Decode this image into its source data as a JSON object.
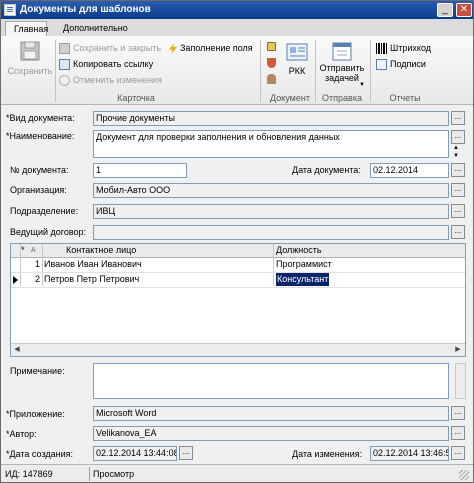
{
  "window": {
    "title": "Документы для шаблонов",
    "minimize_glyph": "_",
    "close_glyph": "✕"
  },
  "tabs": {
    "main": "Главная",
    "additional": "Дополнительно"
  },
  "ribbon": {
    "save": "Сохранить",
    "save_close": "Сохранить и закрыть",
    "copy_link": "Копировать ссылку",
    "cancel_changes": "Отменить изменения",
    "fill_fields": "Заполнение поля",
    "card_group": "Карточка",
    "rkk": "РКК",
    "document_group": "Документ",
    "send_tasks_1": "Отправить",
    "send_tasks_2": "задачей",
    "send_group": "Отправка",
    "barcode": "Штрихкод",
    "signatures": "Подписи",
    "reports_group": "Отчеты"
  },
  "form": {
    "doc_type_label": "*Вид документа:",
    "doc_type_value": "Прочие документы",
    "name_label": "*Наименование:",
    "name_value": "Документ для проверки заполнения и обновления данных",
    "doc_num_label": "№ документа:",
    "doc_num_value": "1",
    "doc_date_label": "Дата документа:",
    "doc_date_value": "02.12.2014",
    "org_label": "Организация:",
    "org_value": "Мобил-Авто ООО",
    "dept_label": "Подразделение:",
    "dept_value": "ИВЦ",
    "contract_label": "Ведущий договор:",
    "contract_value": "",
    "note_label": "Примечание:",
    "note_value": "",
    "app_label": "*Приложение:",
    "app_value": "Microsoft Word",
    "author_label": "*Автор:",
    "author_value": "Velikanova_EA",
    "created_label": "*Дата создания:",
    "created_value": "02.12.2014 13:44:08",
    "changed_label": "Дата изменения:",
    "changed_value": "02.12.2014 13:46:57",
    "dots": "..."
  },
  "grid": {
    "headers": {
      "marker": "*",
      "num": "A",
      "contact": "Контактное лицо",
      "position": "Должность"
    },
    "rows": [
      {
        "n": "1",
        "contact": "Иванов Иван Иванович",
        "position": "Программист"
      },
      {
        "n": "2",
        "contact": "Петров Петр Петрович",
        "position": "Консультант"
      }
    ]
  },
  "status": {
    "id": "ИД: 147869",
    "mode": "Просмотр"
  },
  "colors": {
    "titlebar": "#0a3a8c",
    "selection": "#0a246a",
    "field_border": "#7f9db9"
  }
}
